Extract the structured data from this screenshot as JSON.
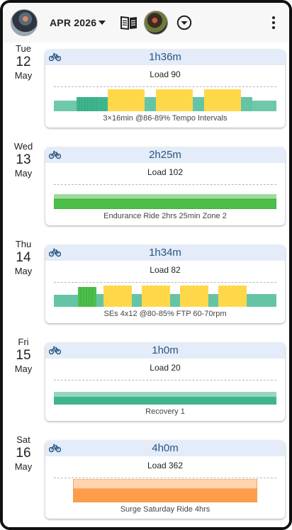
{
  "header": {
    "month": "APR 2026",
    "icons": [
      "avatar",
      "caret-down-icon",
      "book-icon",
      "avatar",
      "circle-chevron-down-icon",
      "more-vert-icon"
    ]
  },
  "colors": {
    "card_header_bg": "#e3ecf8",
    "duration_text": "#2b5580",
    "zone1": "#3fb58f",
    "zone2": "#4cbf4a",
    "zone3": "#ffd84a",
    "zone6": "#ff9d4a"
  },
  "days": [
    {
      "dow": "Tue",
      "day": "12",
      "month": "May",
      "duration": "1h36m",
      "load": "Load 90",
      "description": "3×16min @86-89% Tempo Intervals"
    },
    {
      "dow": "Wed",
      "day": "13",
      "month": "May",
      "duration": "2h25m",
      "load": "Load 102",
      "description": "Endurance Ride 2hrs 25min Zone 2"
    },
    {
      "dow": "Thu",
      "day": "14",
      "month": "May",
      "duration": "1h34m",
      "load": "Load 82",
      "description": "SEs 4x12 @80-85% FTP 60-70rpm"
    },
    {
      "dow": "Fri",
      "day": "15",
      "month": "May",
      "duration": "1h0m",
      "load": "Load 20",
      "description": "Recovery 1"
    },
    {
      "dow": "Sat",
      "day": "16",
      "month": "May",
      "duration": "4h0m",
      "load": "Load 362",
      "description": "Surge Saturday Ride 4hrs"
    }
  ]
}
